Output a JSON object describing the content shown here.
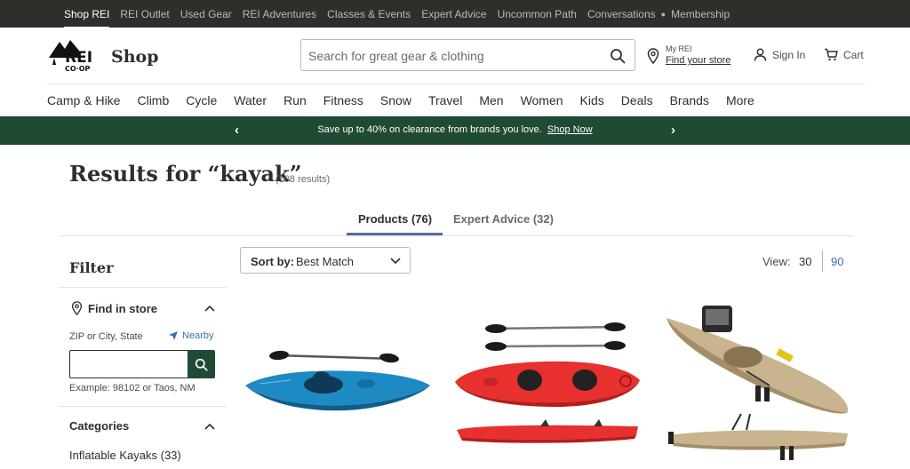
{
  "topnav": {
    "links": [
      "Shop REI",
      "REI Outlet",
      "Used Gear",
      "REI Adventures",
      "Classes & Events",
      "Expert Advice",
      "Uncommon Path",
      "Conversations"
    ],
    "membership": "Membership",
    "active_index": 0
  },
  "header": {
    "logo_text": "REI CO-OP",
    "shop_label": "Shop",
    "search_placeholder": "Search for great gear & clothing",
    "my_rei_label": "My REI",
    "find_store_label": "Find your store",
    "sign_in_label": "Sign In",
    "cart_label": "Cart"
  },
  "nav": {
    "items": [
      "Camp & Hike",
      "Climb",
      "Cycle",
      "Water",
      "Run",
      "Fitness",
      "Snow",
      "Travel",
      "Men",
      "Women",
      "Kids",
      "Deals",
      "Brands",
      "More"
    ]
  },
  "promo": {
    "message": "Save up to 40% on clearance from brands you love.",
    "link": "Shop Now",
    "prev_arrow": "‹",
    "next_arrow": "›"
  },
  "results": {
    "title": "Results for “kayak”",
    "count": "(108 results)"
  },
  "tabs": {
    "products": "Products (76)",
    "expert_advice": "Expert Advice (32)",
    "active": "products"
  },
  "filter": {
    "title": "Filter",
    "find_in_store": "Find in store",
    "zip_label": "ZIP or City, State",
    "nearby_label": "Nearby",
    "zip_value": "",
    "example": "Example: 98102 or Taos, NM",
    "categories_title": "Categories",
    "categories": [
      {
        "label": "Inflatable Kayaks (33)"
      }
    ]
  },
  "sort": {
    "label": "Sort by:",
    "value": "Best Match"
  },
  "view": {
    "label": "View:",
    "options": [
      "30",
      "90"
    ],
    "selected": "30"
  },
  "products": [
    {
      "image": "blue-sit-in-kayak-with-paddle",
      "color": "#1e8ac4"
    },
    {
      "image": "red-tandem-kayak-with-two-paddles",
      "color": "#e8302e"
    },
    {
      "image": "tan-pedal-fishing-kayak",
      "color": "#c9b48f"
    }
  ],
  "colors": {
    "topbar": "#2e2e2b",
    "promo": "#1f4a34",
    "accent_blue": "#4b6fa3",
    "link_blue": "#3d6fb0"
  }
}
